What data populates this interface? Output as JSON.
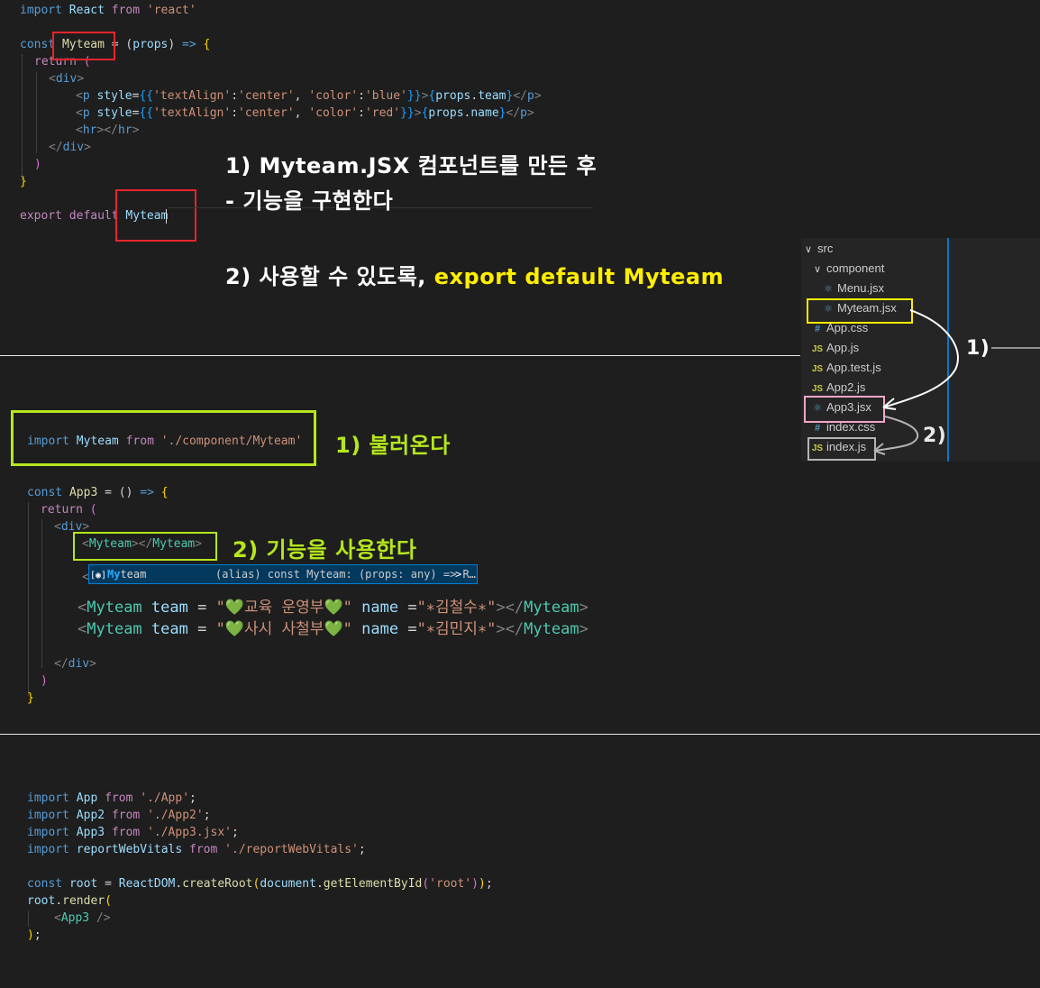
{
  "section1": {
    "lines": [
      {
        "parts": [
          [
            "kw",
            "import"
          ],
          [
            "plain",
            " "
          ],
          [
            "ident",
            "React"
          ],
          [
            "plain",
            " "
          ],
          [
            "ctrl",
            "from"
          ],
          [
            "plain",
            " "
          ],
          [
            "str",
            "'react'"
          ]
        ]
      },
      {
        "parts": [
          [
            "kw",
            "const"
          ],
          [
            "plain",
            " "
          ],
          [
            "fn",
            "Myteam"
          ],
          [
            "plain",
            " = ("
          ],
          [
            "ident",
            "props"
          ],
          [
            "plain",
            ") "
          ],
          [
            "kw",
            "=>"
          ],
          [
            "plain",
            " "
          ],
          [
            "brace",
            "{"
          ]
        ]
      },
      {
        "parts": [
          [
            "ctrl",
            "return"
          ],
          [
            "plain",
            " "
          ],
          [
            "brace2",
            "("
          ]
        ]
      },
      {
        "parts": [
          [
            "punct",
            "<"
          ],
          [
            "tag",
            "div"
          ],
          [
            "punct",
            ">"
          ]
        ]
      },
      {
        "parts": [
          [
            "punct",
            "<"
          ],
          [
            "tag",
            "p"
          ],
          [
            "plain",
            " "
          ],
          [
            "ident",
            "style"
          ],
          [
            "plain",
            "="
          ],
          [
            "brace3",
            "{{"
          ],
          [
            "str",
            "'textAlign'"
          ],
          [
            "plain",
            ":"
          ],
          [
            "str",
            "'center'"
          ],
          [
            "plain",
            ", "
          ],
          [
            "str",
            "'color'"
          ],
          [
            "plain",
            ":"
          ],
          [
            "str",
            "'blue'"
          ],
          [
            "brace3",
            "}}"
          ],
          [
            "punct",
            ">"
          ],
          [
            "brace3",
            "{"
          ],
          [
            "ident",
            "props"
          ],
          [
            "plain",
            "."
          ],
          [
            "ident",
            "team"
          ],
          [
            "brace3",
            "}"
          ],
          [
            "punct",
            "</"
          ],
          [
            "tag",
            "p"
          ],
          [
            "punct",
            ">"
          ]
        ]
      },
      {
        "parts": [
          [
            "punct",
            "<"
          ],
          [
            "tag",
            "p"
          ],
          [
            "plain",
            " "
          ],
          [
            "ident",
            "style"
          ],
          [
            "plain",
            "="
          ],
          [
            "brace3",
            "{{"
          ],
          [
            "str",
            "'textAlign'"
          ],
          [
            "plain",
            ":"
          ],
          [
            "str",
            "'center'"
          ],
          [
            "plain",
            ", "
          ],
          [
            "str",
            "'color'"
          ],
          [
            "plain",
            ":"
          ],
          [
            "str",
            "'red'"
          ],
          [
            "brace3",
            "}}"
          ],
          [
            "punct",
            ">"
          ],
          [
            "brace3",
            "{"
          ],
          [
            "ident",
            "props"
          ],
          [
            "plain",
            "."
          ],
          [
            "ident",
            "name"
          ],
          [
            "brace3",
            "}"
          ],
          [
            "punct",
            "</"
          ],
          [
            "tag",
            "p"
          ],
          [
            "punct",
            ">"
          ]
        ]
      },
      {
        "parts": [
          [
            "punct",
            "<"
          ],
          [
            "tag",
            "hr"
          ],
          [
            "punct",
            "></"
          ],
          [
            "tag",
            "hr"
          ],
          [
            "punct",
            ">"
          ]
        ]
      },
      {
        "parts": [
          [
            "punct",
            "</"
          ],
          [
            "tag",
            "div"
          ],
          [
            "punct",
            ">"
          ]
        ]
      },
      {
        "parts": [
          [
            "brace2",
            ")"
          ]
        ]
      },
      {
        "parts": [
          [
            "brace",
            "}"
          ]
        ]
      },
      {
        "parts": [
          [
            "ctrl",
            "export"
          ],
          [
            "plain",
            " "
          ],
          [
            "ctrl",
            "default"
          ],
          [
            "plain",
            " "
          ],
          [
            "ident",
            "Myteam"
          ]
        ]
      }
    ]
  },
  "annotations": {
    "a1_line1": "1) Myteam.JSX 컴포넌트를 만든 후",
    "a1_line2": "- 기능을 구현한다",
    "a2_prefix": "2) 사용할 수 있도록, ",
    "a2_highlight": "export default Myteam",
    "b1": "1) 불러온다",
    "b2": "2) 기능을 사용한다",
    "ex1": "1)",
    "ex2": "2)"
  },
  "section2": {
    "import_line": {
      "parts": [
        [
          "kw",
          "import"
        ],
        [
          "plain",
          " "
        ],
        [
          "ident",
          "Myteam"
        ],
        [
          "plain",
          " "
        ],
        [
          "ctrl",
          "from"
        ],
        [
          "plain",
          " "
        ],
        [
          "str",
          "'./component/Myteam'"
        ]
      ]
    },
    "lines": [
      {
        "parts": [
          [
            "kw",
            "const"
          ],
          [
            "plain",
            " "
          ],
          [
            "fn",
            "App3"
          ],
          [
            "plain",
            " = () "
          ],
          [
            "kw",
            "=>"
          ],
          [
            "plain",
            " "
          ],
          [
            "brace",
            "{"
          ]
        ]
      },
      {
        "parts": [
          [
            "ctrl",
            "return"
          ],
          [
            "plain",
            " "
          ],
          [
            "brace2",
            "("
          ]
        ]
      },
      {
        "parts": [
          [
            "punct",
            "<"
          ],
          [
            "tag",
            "div"
          ],
          [
            "punct",
            ">"
          ]
        ]
      },
      {
        "parts": [
          [
            "punct",
            "<"
          ],
          [
            "comp",
            "Myteam"
          ],
          [
            "punct",
            "></"
          ],
          [
            "comp",
            "Myteam"
          ],
          [
            "punct",
            ">"
          ]
        ]
      }
    ],
    "autocomplete": {
      "icon": "[◉]",
      "match": "My",
      "rest": "team",
      "detail": "(alias) const Myteam: (props: any) => R…",
      "chevron": ">"
    },
    "big_lines": [
      {
        "open": "<",
        "tag": "Myteam",
        "attr1": "team",
        "eq1": " = ",
        "q1": "\"",
        "heart": "💚",
        "val1": "교육 운영부",
        "q2": "\"",
        "attr2": "name",
        "eq2": " =",
        "val2": "\"∗김철수∗\"",
        "close": "></",
        "ctag": "Myteam",
        "end": ">"
      },
      {
        "open": "<",
        "tag": "Myteam",
        "attr1": "team",
        "eq1": " = ",
        "q1": "\"",
        "heart": "💚",
        "val1": "사시 사철부",
        "q2": "\"",
        "attr2": "name",
        "eq2": " =",
        "val2": "\"∗김민지∗\"",
        "close": "></",
        "ctag": "Myteam",
        "end": ">"
      }
    ],
    "tail_lines": [
      {
        "parts": [
          [
            "punct",
            "</"
          ],
          [
            "tag",
            "div"
          ],
          [
            "punct",
            ">"
          ]
        ]
      },
      {
        "parts": [
          [
            "brace2",
            ")"
          ]
        ]
      },
      {
        "parts": [
          [
            "brace",
            "}"
          ]
        ]
      }
    ]
  },
  "section3": {
    "lines": [
      {
        "parts": [
          [
            "kw",
            "import"
          ],
          [
            "plain",
            " "
          ],
          [
            "ident",
            "App"
          ],
          [
            "plain",
            " "
          ],
          [
            "ctrl",
            "from"
          ],
          [
            "plain",
            " "
          ],
          [
            "str",
            "'./App'"
          ],
          [
            "plain",
            ";"
          ]
        ]
      },
      {
        "parts": [
          [
            "kw",
            "import"
          ],
          [
            "plain",
            " "
          ],
          [
            "ident",
            "App2"
          ],
          [
            "plain",
            " "
          ],
          [
            "ctrl",
            "from"
          ],
          [
            "plain",
            " "
          ],
          [
            "str",
            "'./App2'"
          ],
          [
            "plain",
            ";"
          ]
        ]
      },
      {
        "parts": [
          [
            "kw",
            "import"
          ],
          [
            "plain",
            " "
          ],
          [
            "ident",
            "App3"
          ],
          [
            "plain",
            " "
          ],
          [
            "ctrl",
            "from"
          ],
          [
            "plain",
            " "
          ],
          [
            "str",
            "'./App3.jsx'"
          ],
          [
            "plain",
            ";"
          ]
        ]
      },
      {
        "parts": [
          [
            "kw",
            "import"
          ],
          [
            "plain",
            " "
          ],
          [
            "ident",
            "reportWebVitals"
          ],
          [
            "plain",
            " "
          ],
          [
            "ctrl",
            "from"
          ],
          [
            "plain",
            " "
          ],
          [
            "str",
            "'./reportWebVitals'"
          ],
          [
            "plain",
            ";"
          ]
        ]
      },
      {
        "parts": []
      },
      {
        "parts": [
          [
            "kw",
            "const"
          ],
          [
            "plain",
            " "
          ],
          [
            "ident",
            "root"
          ],
          [
            "plain",
            " = "
          ],
          [
            "ident",
            "ReactDOM"
          ],
          [
            "plain",
            "."
          ],
          [
            "fn",
            "createRoot"
          ],
          [
            "brace",
            "("
          ],
          [
            "ident",
            "document"
          ],
          [
            "plain",
            "."
          ],
          [
            "fn",
            "getElementById"
          ],
          [
            "brace2",
            "("
          ],
          [
            "str",
            "'root'"
          ],
          [
            "brace2",
            ")"
          ],
          [
            "brace",
            ")"
          ],
          [
            "plain",
            ";"
          ]
        ]
      },
      {
        "parts": [
          [
            "ident",
            "root"
          ],
          [
            "plain",
            "."
          ],
          [
            "fn",
            "render"
          ],
          [
            "brace",
            "("
          ]
        ]
      },
      {
        "parts": [
          [
            "punct",
            "<"
          ],
          [
            "comp",
            "App3"
          ],
          [
            "plain",
            " "
          ],
          [
            "punct",
            "/>"
          ]
        ]
      },
      {
        "parts": [
          [
            "brace",
            ")"
          ],
          [
            "plain",
            ";"
          ]
        ]
      }
    ]
  },
  "explorer": {
    "items": [
      {
        "chev": "∨",
        "icon": "",
        "label": "src",
        "level": 0
      },
      {
        "chev": "∨",
        "icon": "",
        "label": "component",
        "level": 1
      },
      {
        "chev": "",
        "icon": "react",
        "label": "Menu.jsx",
        "level": 2
      },
      {
        "chev": "",
        "icon": "react",
        "label": "Myteam.jsx",
        "level": 2
      },
      {
        "chev": "",
        "icon": "css",
        "label": "App.css",
        "level": 1
      },
      {
        "chev": "",
        "icon": "js",
        "label": "App.js",
        "level": 1
      },
      {
        "chev": "",
        "icon": "js",
        "label": "App.test.js",
        "level": 1
      },
      {
        "chev": "",
        "icon": "js",
        "label": "App2.js",
        "level": 1
      },
      {
        "chev": "",
        "icon": "react",
        "label": "App3.jsx",
        "level": 1
      },
      {
        "chev": "",
        "icon": "css",
        "label": "index.css",
        "level": 1
      },
      {
        "chev": "",
        "icon": "js",
        "label": "index.js",
        "level": 1
      }
    ]
  },
  "colors": {
    "red_box": "#e8242b",
    "green_box": "#b5e61d",
    "yellow_box": "#ffee00",
    "pink_box": "#f4a6c8",
    "gray_box": "#b4b4b4"
  }
}
